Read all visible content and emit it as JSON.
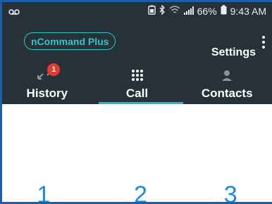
{
  "status_bar": {
    "battery_percent": "66%",
    "time": "9:43 AM",
    "icons": [
      "voicemail-icon",
      "battery-saver-icon",
      "bluetooth-icon",
      "wifi-icon",
      "signal-icon",
      "battery-icon"
    ]
  },
  "app_bar": {
    "app_label": "nCommand Plus",
    "settings_label": "Settings",
    "background": "#263238",
    "accent": "#31c4cc"
  },
  "tabs": [
    {
      "label": "History",
      "icon": "call-history-icon",
      "badge": "1"
    },
    {
      "label": "Call",
      "icon": "dialpad-icon",
      "active": true
    },
    {
      "label": "Contacts",
      "icon": "person-icon"
    }
  ],
  "dialpad": {
    "keys": [
      "1",
      "2",
      "3"
    ],
    "digit_color": "#1e88e5"
  }
}
